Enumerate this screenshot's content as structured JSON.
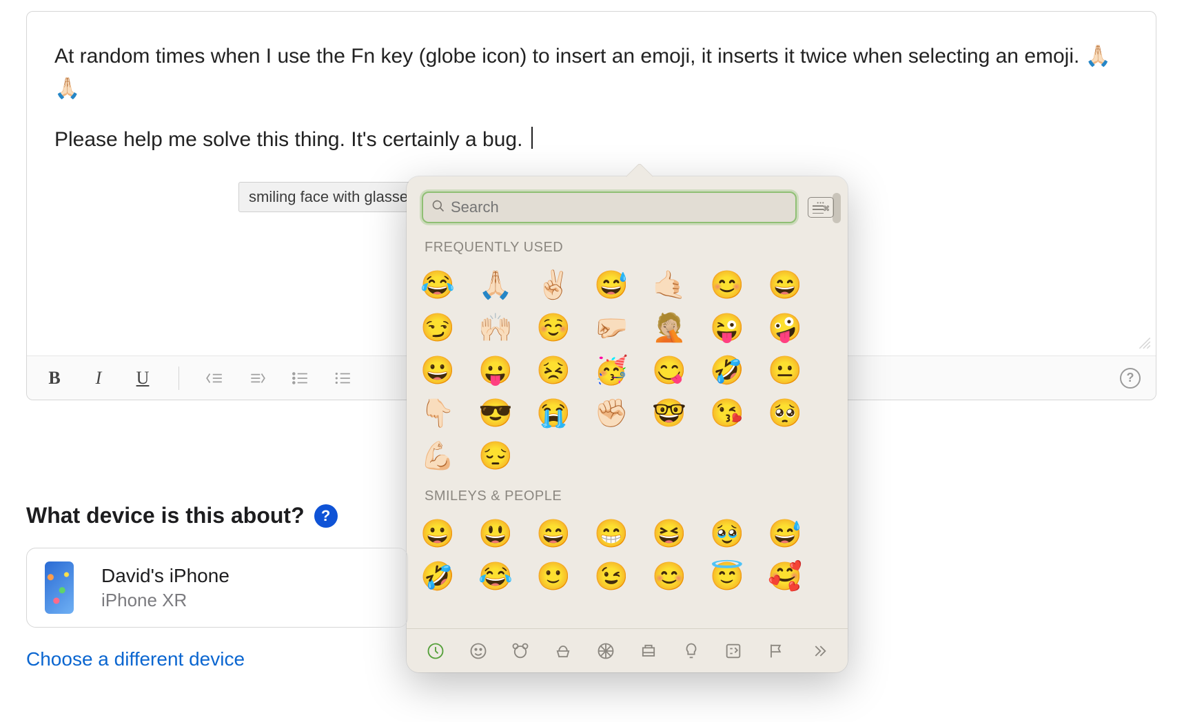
{
  "editor": {
    "paragraph1_prefix": "At random times when I use the Fn key (globe icon) to insert an emoji, it inserts it twice when selecting an emoji. ",
    "paragraph1_emoji": "🙏🏻🙏🏻",
    "paragraph2": "Please help me solve this thing. It's certainly a bug. "
  },
  "toolbar": {
    "bold": "B",
    "italic": "I",
    "underline": "U",
    "help": "?"
  },
  "device": {
    "heading": "What device is this about?",
    "info": "?",
    "name": "David's iPhone",
    "model": "iPhone XR",
    "choose_link": "Choose a different device"
  },
  "picker": {
    "tooltip": "smiling face with glasses",
    "search_placeholder": "Search",
    "frequently_used_label": "FREQUENTLY USED",
    "smileys_label": "SMILEYS & PEOPLE",
    "frequent": [
      [
        "😂",
        "🙏🏻",
        "✌🏻",
        "😅",
        "🤙🏻",
        "😊",
        "😄"
      ],
      [
        "😏",
        "🙌🏻",
        "☺️",
        "🤛🏻",
        "🤦🏼",
        "😜",
        "🤪"
      ],
      [
        "😀",
        "😛",
        "😣",
        "🥳",
        "😋",
        "🤣",
        "😐"
      ],
      [
        "👇🏻",
        "😎",
        "😭",
        "✊🏻",
        "🤓",
        "😘",
        "🥺"
      ],
      [
        "💪🏻",
        "😔"
      ]
    ],
    "smileys": [
      [
        "😀",
        "😃",
        "😄",
        "😁",
        "😆",
        "🥹",
        "😅"
      ],
      [
        "🤣",
        "😂",
        "🙂",
        "😉",
        "😊",
        "😇",
        "🥰"
      ]
    ],
    "categories": [
      "recent",
      "smileys",
      "animals",
      "food",
      "activity",
      "travel",
      "objects",
      "symbols",
      "flags",
      "more"
    ]
  }
}
